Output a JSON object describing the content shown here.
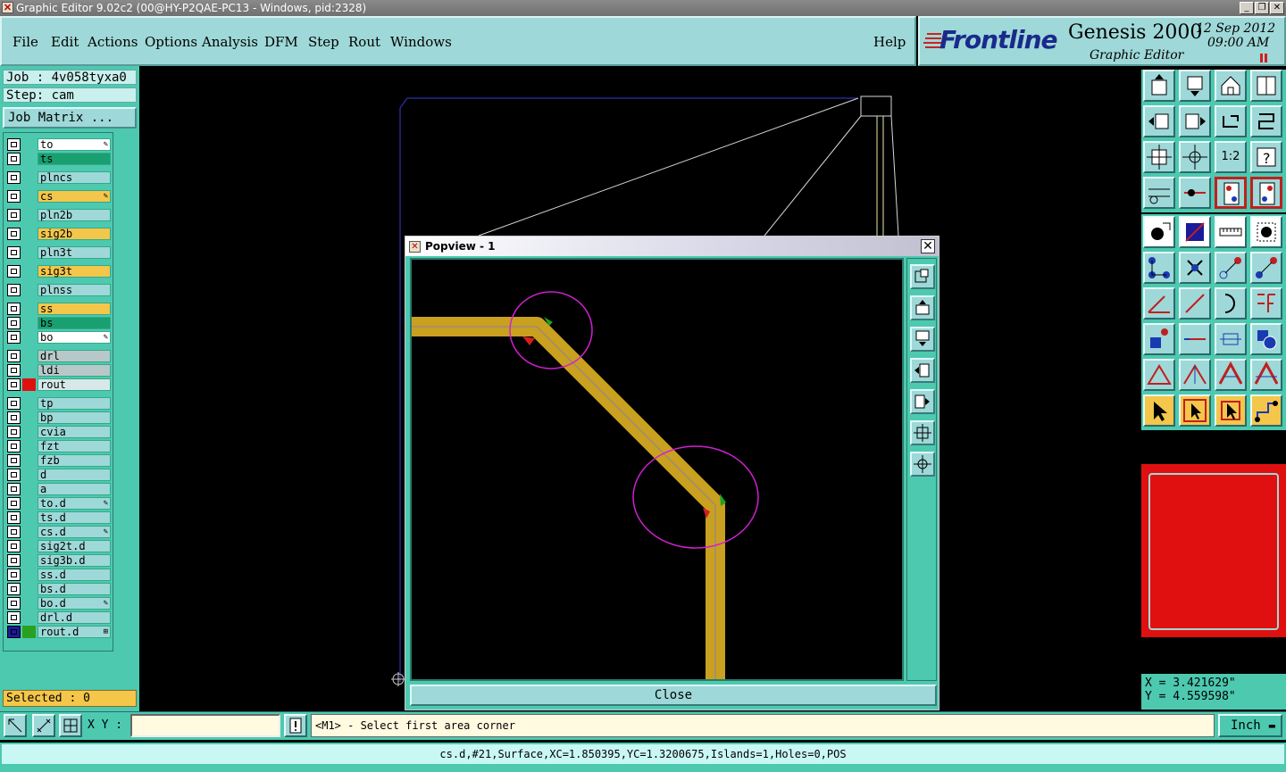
{
  "window": {
    "title": "Graphic Editor 9.02c2 (00@HY-P2QAE-PC13 - Windows, pid:2328)",
    "controls": [
      "minimize",
      "restore",
      "close"
    ]
  },
  "menu": {
    "items": [
      "File",
      "Edit",
      "Actions",
      "Options",
      "Analysis",
      "DFM",
      "Step",
      "Rout",
      "Windows"
    ],
    "help": "Help"
  },
  "brand": {
    "logo": "Frontline",
    "product": "Genesis 2000",
    "subtitle": "Graphic Editor",
    "date": "12 Sep 2012",
    "time": "09:00 AM"
  },
  "job": {
    "job_label": "Job : 4v058tyxa0",
    "step_label": "Step: cam",
    "matrix_button": "Job Matrix ..."
  },
  "layers": [
    {
      "name": "to",
      "color": "#ffffff",
      "mark": "✎",
      "swatch": ""
    },
    {
      "name": "ts",
      "color": "#1aa070",
      "mark": "",
      "swatch": ""
    },
    {
      "name": "plncs",
      "color": "#9fd8d8",
      "mark": "",
      "swatch": ""
    },
    {
      "name": "cs",
      "color": "#f4c64a",
      "mark": "✎",
      "swatch": ""
    },
    {
      "name": "pln2b",
      "color": "#9fd8d8",
      "mark": "",
      "swatch": ""
    },
    {
      "name": "sig2b",
      "color": "#f4c64a",
      "mark": "",
      "swatch": ""
    },
    {
      "name": "pln3t",
      "color": "#9fd8d8",
      "mark": "",
      "swatch": ""
    },
    {
      "name": "sig3t",
      "color": "#f4c64a",
      "mark": "",
      "swatch": ""
    },
    {
      "name": "plnss",
      "color": "#9fd8d8",
      "mark": "",
      "swatch": ""
    },
    {
      "name": "ss",
      "color": "#f4c64a",
      "mark": "",
      "swatch": ""
    },
    {
      "name": "bs",
      "color": "#1aa070",
      "mark": "",
      "swatch": ""
    },
    {
      "name": "bo",
      "color": "#ffffff",
      "mark": "✎",
      "swatch": ""
    },
    {
      "name": "drl",
      "color": "#b8c8c8",
      "mark": "",
      "swatch": ""
    },
    {
      "name": "ldi",
      "color": "#b8c8c8",
      "mark": "",
      "swatch": ""
    },
    {
      "name": "rout",
      "color": "#d8e8e8",
      "mark": "",
      "swatch": "#e01010"
    },
    {
      "name": "tp",
      "color": "#9fd8d8",
      "mark": "",
      "swatch": ""
    },
    {
      "name": "bp",
      "color": "#9fd8d8",
      "mark": "",
      "swatch": ""
    },
    {
      "name": "cvia",
      "color": "#9fd8d8",
      "mark": "",
      "swatch": ""
    },
    {
      "name": "fzt",
      "color": "#9fd8d8",
      "mark": "",
      "swatch": ""
    },
    {
      "name": "fzb",
      "color": "#9fd8d8",
      "mark": "",
      "swatch": ""
    },
    {
      "name": "d",
      "color": "#9fd8d8",
      "mark": "",
      "swatch": ""
    },
    {
      "name": "a",
      "color": "#9fd8d8",
      "mark": "",
      "swatch": ""
    },
    {
      "name": "to.d",
      "color": "#9fd8d8",
      "mark": "✎",
      "swatch": ""
    },
    {
      "name": "ts.d",
      "color": "#9fd8d8",
      "mark": "",
      "swatch": ""
    },
    {
      "name": "cs.d",
      "color": "#9fd8d8",
      "mark": "✎",
      "swatch": ""
    },
    {
      "name": "sig2t.d",
      "color": "#9fd8d8",
      "mark": "",
      "swatch": ""
    },
    {
      "name": "sig3b.d",
      "color": "#9fd8d8",
      "mark": "",
      "swatch": ""
    },
    {
      "name": "ss.d",
      "color": "#9fd8d8",
      "mark": "",
      "swatch": ""
    },
    {
      "name": "bs.d",
      "color": "#9fd8d8",
      "mark": "",
      "swatch": ""
    },
    {
      "name": "bo.d",
      "color": "#9fd8d8",
      "mark": "✎",
      "swatch": ""
    },
    {
      "name": "drl.d",
      "color": "#9fd8d8",
      "mark": "",
      "swatch": ""
    },
    {
      "name": "rout.d",
      "color": "#9fd8d8",
      "mark": "⊞",
      "swatch": "#2aa020"
    }
  ],
  "selected_label": "Selected : 0",
  "popview": {
    "title": "Popview - 1",
    "close_label": "Close",
    "tools": [
      "popview-zoom-icon",
      "pan-up-icon",
      "pan-down-icon",
      "pan-left-icon",
      "pan-right-icon",
      "zoom-fit-icon",
      "zoom-home-icon"
    ]
  },
  "toolbar": {
    "zoom_ratio_label": "1:2"
  },
  "coords": {
    "x": "X = 3.421629\"",
    "y": "Y = 4.559598\""
  },
  "command": {
    "xy_label": "X Y :",
    "xy_value": "",
    "prompt": "<M1> - Select first area corner",
    "unit": "Inch"
  },
  "status": "cs.d,#21,Surface,XC=1.850395,YC=1.3200675,Islands=1,Holes=0,POS",
  "colors": {
    "panel_teal": "#4dc9b0",
    "button_cyan": "#9fd8d8",
    "trace_gold": "#c9a020",
    "highlight_magenta": "#d020d0",
    "red_view": "#e01010"
  }
}
